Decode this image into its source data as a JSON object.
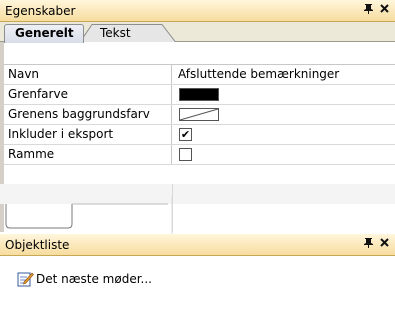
{
  "properties_pane": {
    "title": "Egenskaber",
    "pin_glyph": "ᵖ",
    "close_glyph": "✕",
    "tabs": [
      {
        "label": "Generelt",
        "active": true
      },
      {
        "label": "Tekst",
        "active": false
      }
    ],
    "rows": [
      {
        "label": "Navn",
        "value": "Afsluttende bemærkninger",
        "kind": "text"
      },
      {
        "label": "Grenfarve",
        "value": "",
        "kind": "color",
        "color": "#000000"
      },
      {
        "label": "Grenens baggrundsfarv",
        "value": "",
        "kind": "color-none"
      },
      {
        "label": "Inkluder i eksport",
        "value": "",
        "kind": "checkbox",
        "checked": true
      },
      {
        "label": "Ramme",
        "value": "",
        "kind": "checkbox",
        "checked": false
      }
    ]
  },
  "object_list_pane": {
    "title": "Objektliste",
    "items": [
      {
        "label": "Det næste møder...",
        "icon": "document-pen-icon"
      }
    ]
  },
  "colors": {
    "header_gradient_top": "#fff6dc",
    "header_gradient_bottom": "#f7dc9e",
    "tab_strip": "#ece9d8"
  }
}
